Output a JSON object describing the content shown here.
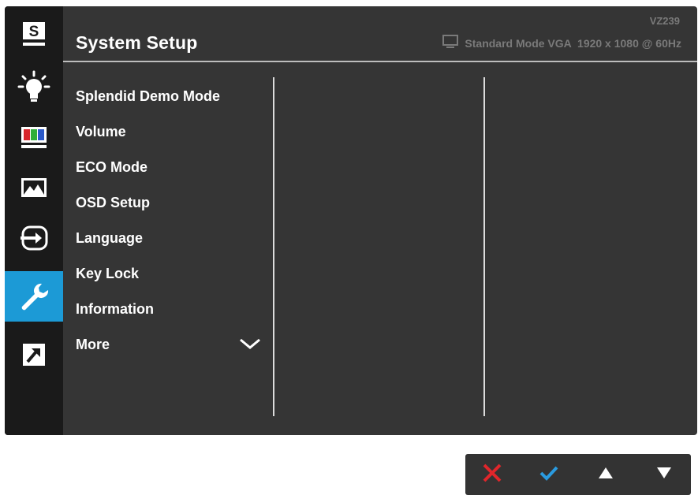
{
  "header": {
    "title": "System Setup",
    "model": "VZ239",
    "status": "Standard Mode VGA  1920 x 1080 @ 60Hz"
  },
  "sidebar": {
    "items": [
      {
        "icon": "splendid-s-icon",
        "label": "S"
      },
      {
        "icon": "brightness-bulb-icon"
      },
      {
        "icon": "color-bars-icon"
      },
      {
        "icon": "image-landscape-icon"
      },
      {
        "icon": "input-select-icon"
      },
      {
        "icon": "wrench-icon",
        "active": true
      },
      {
        "icon": "shortcut-arrow-icon"
      }
    ]
  },
  "menu": {
    "items": [
      {
        "label": "Splendid Demo Mode"
      },
      {
        "label": "Volume"
      },
      {
        "label": "ECO Mode"
      },
      {
        "label": "OSD Setup"
      },
      {
        "label": "Language"
      },
      {
        "label": "Key Lock"
      },
      {
        "label": "Information"
      },
      {
        "label": "More",
        "icon": "chevron-down-icon"
      }
    ]
  },
  "buttons": [
    {
      "icon": "close-x-icon",
      "color": "#e0262b"
    },
    {
      "icon": "check-icon",
      "color": "#2a9be0"
    },
    {
      "icon": "up-triangle-icon",
      "color": "#ffffff"
    },
    {
      "icon": "down-triangle-icon",
      "color": "#ffffff"
    }
  ],
  "colors": {
    "accent": "#1c9ad6",
    "panel": "#353535",
    "sidebar": "#1a1a1a"
  }
}
